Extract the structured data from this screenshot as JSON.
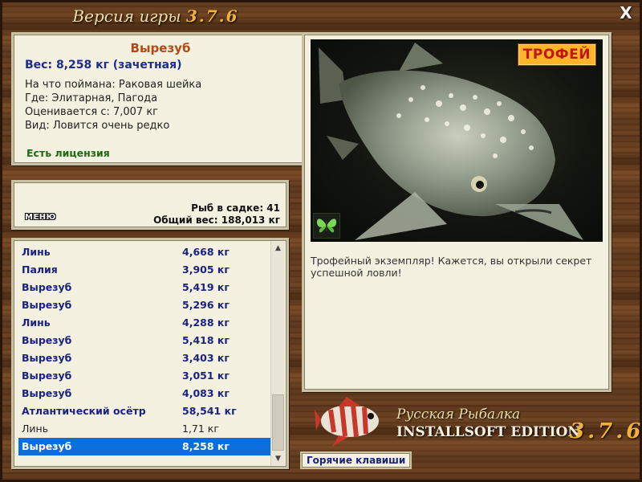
{
  "header": {
    "title_prefix": "Версия игры",
    "title_version": "3.7.6",
    "close_label": "X"
  },
  "info": {
    "fish_name": "Вырезуб",
    "weight": "Вес: 8,258 кг (зачетная)",
    "caught_on": "На что поймана: Раковая шейка",
    "location": "Где: Элитарная, Пагода",
    "min_weight": "Оценивается с: 7,007 кг",
    "rarity": "Вид: Ловится очень редко",
    "license": "Есть лицензия"
  },
  "stats": {
    "menu_label": "МЕНЮ",
    "fish_count": "Рыб в садке: 41",
    "total_weight": "Общий вес: 188,013 кг"
  },
  "catch_list": [
    {
      "name": "Линь",
      "weight": "4,668 кг",
      "style": "bold"
    },
    {
      "name": "Палия",
      "weight": "3,905 кг",
      "style": "bold"
    },
    {
      "name": "Вырезуб",
      "weight": "5,419 кг",
      "style": "bold"
    },
    {
      "name": "Вырезуб",
      "weight": "5,296 кг",
      "style": "bold"
    },
    {
      "name": "Линь",
      "weight": "4,288 кг",
      "style": "bold"
    },
    {
      "name": "Вырезуб",
      "weight": "5,418 кг",
      "style": "bold"
    },
    {
      "name": "Вырезуб",
      "weight": "3,403 кг",
      "style": "bold"
    },
    {
      "name": "Вырезуб",
      "weight": "3,051 кг",
      "style": "bold"
    },
    {
      "name": "Вырезуб",
      "weight": "4,083 кг",
      "style": "bold"
    },
    {
      "name": "Атлантический осётр",
      "weight": "58,541 кг",
      "style": "bold"
    },
    {
      "name": "Линь",
      "weight": "1,71 кг",
      "style": "plain"
    },
    {
      "name": "Вырезуб",
      "weight": "8,258 кг",
      "style": "selected"
    }
  ],
  "trophy": {
    "badge": "ТРОФЕЙ",
    "description": "Трофейный экземпляр! Кажется, вы открыли секрет успешной ловли!"
  },
  "logo": {
    "line1": "Русская Рыбалка",
    "line2": "INSTALLSOFT EDITION",
    "version": "3.7.6"
  },
  "hotkeys_label": "Горячие клавиши",
  "colors": {
    "accent_orange": "#f2b23a",
    "link_blue": "#1a2380",
    "selected_row": "#0c6ddc",
    "fish_name": "#b34a14",
    "license_green": "#1c6b12"
  }
}
